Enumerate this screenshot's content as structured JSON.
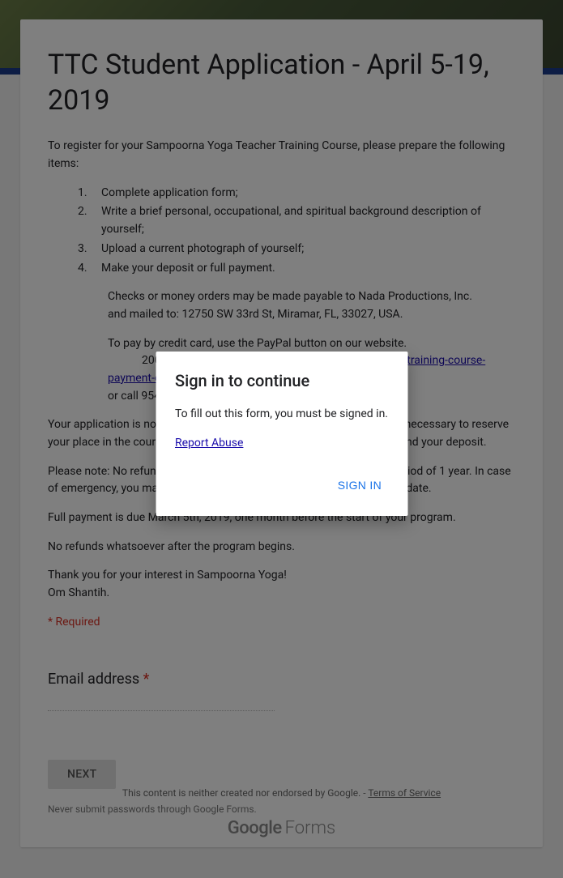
{
  "form": {
    "title": "TTC Student Application - April 5-19, 2019",
    "intro": "To register for your Sampoorna Yoga Teacher Training Course, please prepare the following items:",
    "steps": [
      "Complete application form;",
      "Write a brief personal, occupational, and spiritual background description of yourself;",
      "Upload a current photograph of yourself;",
      "Make your deposit or full payment."
    ],
    "payment_block_1": "Checks or money orders may be made payable to Nada Productions, Inc.",
    "payment_block_2": "and mailed to: 12750 SW 33rd St, Miramar, FL, 33027, USA.",
    "paypal_line": "To pay by credit card, use the PayPal button on our website.",
    "paypal_prefix": "200-hour: ",
    "paypal_link": "www.yogihari.com/200-hour-yoga-teacher-training-course-payment-options/",
    "call_line": "or call 954-399-8000.",
    "para_deposit": "Your application is not complete until we receive your deposit, which is necessary to reserve your place in the course. If your application is not approved, we will refund your deposit.",
    "para_refund": "Please note: No refunds on deposits. Deposits are transferable for a period of 1 year. In case of emergency, you may transfer your deposit toward a different training date.",
    "para_due": "Full payment is due March 5th, 2019, one month before the start of your program.",
    "para_no_refund": "No refunds whatsoever after the program begins.",
    "para_thanks": "Thank you for your interest in Sampoorna Yoga!",
    "para_om": "Om Shantih.",
    "required_note": "* Required",
    "question_label": "Email address ",
    "question_star": "*",
    "next_label": "NEXT",
    "pw_note": "Never submit passwords through Google Forms."
  },
  "footer": {
    "disclaimer": "This content is neither created nor endorsed by Google. - ",
    "tos": "Terms of Service",
    "brand_g": "Google",
    "brand_f": "Forms"
  },
  "dialog": {
    "title": "Sign in to continue",
    "text": "To fill out this form, you must be signed in.",
    "report": "Report Abuse",
    "signin": "SIGN IN"
  }
}
